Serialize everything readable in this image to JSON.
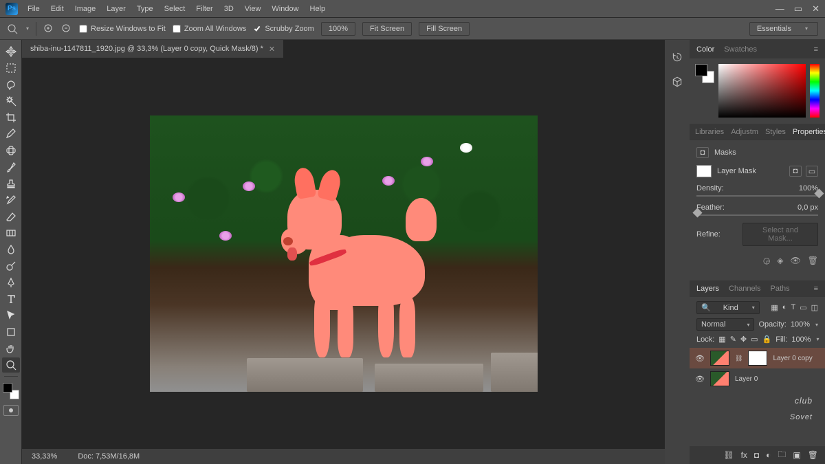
{
  "menubar": {
    "logo": "Ps",
    "items": [
      "File",
      "Edit",
      "Image",
      "Layer",
      "Type",
      "Select",
      "Filter",
      "3D",
      "View",
      "Window",
      "Help"
    ]
  },
  "optionsbar": {
    "resize_windows": "Resize Windows to Fit",
    "zoom_all": "Zoom All Windows",
    "scrubby": "Scrubby Zoom",
    "zoom_pct": "100%",
    "fit_screen": "Fit Screen",
    "fill_screen": "Fill Screen",
    "workspace": "Essentials"
  },
  "document": {
    "tab_title": "shiba-inu-1147811_1920.jpg @ 33,3% (Layer 0 copy, Quick Mask/8) *",
    "zoom_status": "33,33%",
    "doc_info": "Doc: 7,53M/16,8M"
  },
  "color_panel": {
    "tabs": [
      "Color",
      "Swatches"
    ]
  },
  "props_panel": {
    "tabs": [
      "Libraries",
      "Adjustm",
      "Styles",
      "Properties"
    ],
    "section": "Masks",
    "mask_label": "Layer Mask",
    "density_label": "Density:",
    "density_value": "100%",
    "feather_label": "Feather:",
    "feather_value": "0,0 px",
    "refine_label": "Refine:",
    "refine_btn": "Select and Mask..."
  },
  "layers_panel": {
    "tabs": [
      "Layers",
      "Channels",
      "Paths"
    ],
    "kind": "Kind",
    "blend": "Normal",
    "opacity_label": "Opacity:",
    "opacity_value": "100%",
    "lock_label": "Lock:",
    "fill_label": "Fill:",
    "fill_value": "100%",
    "layers": [
      {
        "name": "Layer 0 copy",
        "selected": true,
        "has_mask": true
      },
      {
        "name": "Layer 0",
        "selected": false,
        "has_mask": false
      }
    ]
  },
  "watermark": {
    "small": "club",
    "big": "Sovet"
  }
}
